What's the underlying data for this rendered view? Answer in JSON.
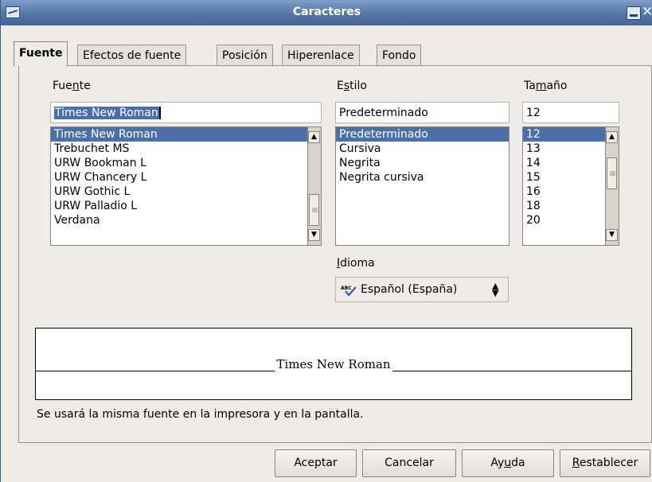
{
  "window": {
    "title": "Caracteres"
  },
  "tabs": [
    {
      "label": "Fuente",
      "active": true
    },
    {
      "label": "Efectos de fuente"
    },
    {
      "label": "Posición"
    },
    {
      "label": "Hiperenlace"
    },
    {
      "label": "Fondo"
    }
  ],
  "font": {
    "label_pre": "Fue",
    "label_u": "n",
    "label_post": "te",
    "value": "Times New Roman",
    "items": [
      "Times New Roman",
      "Trebuchet MS",
      "URW Bookman L",
      "URW Chancery L",
      "URW Gothic L",
      "URW Palladio L",
      "Verdana"
    ],
    "selected": "Times New Roman"
  },
  "style": {
    "label_pre": "E",
    "label_u": "s",
    "label_post": "tilo",
    "value": "Predeterminado",
    "items": [
      "Predeterminado",
      "Cursiva",
      "Negrita",
      "Negrita cursiva"
    ],
    "selected": "Predeterminado"
  },
  "size": {
    "label_pre": "Ta",
    "label_u": "m",
    "label_post": "año",
    "value": "12",
    "items": [
      "12",
      "13",
      "14",
      "15",
      "16",
      "18",
      "20"
    ],
    "selected": "12"
  },
  "language": {
    "label_pre": "",
    "label_u": "I",
    "label_post": "dioma",
    "value": "Español (España)",
    "icon": "spellcheck-icon"
  },
  "preview": {
    "text": "Times New Roman"
  },
  "note": "Se usará la misma fuente en la impresora y en la pantalla.",
  "buttons": {
    "ok": "Aceptar",
    "cancel": "Cancelar",
    "help_pre": "Ay",
    "help_u": "u",
    "help_post": "da",
    "reset_pre": "",
    "reset_u": "R",
    "reset_post": "establecer"
  }
}
